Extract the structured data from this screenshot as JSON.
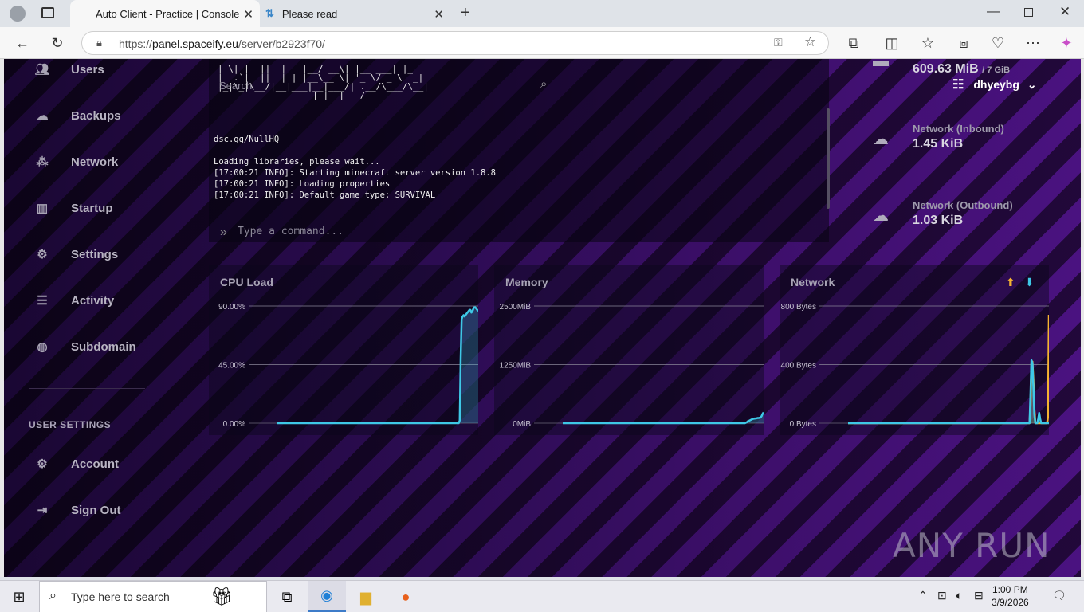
{
  "browser": {
    "tabs": [
      {
        "title": "Auto Client - Practice | Console",
        "active": true
      },
      {
        "title": "Please read",
        "active": false
      }
    ],
    "url_prefix": "https://",
    "url_host": "panel.spaceify.eu",
    "url_path": "/server/b2923f70/"
  },
  "sidebar": {
    "items": [
      {
        "label": "Users",
        "icon": "users-icon"
      },
      {
        "label": "Backups",
        "icon": "cloud-icon"
      },
      {
        "label": "Network",
        "icon": "network-icon"
      },
      {
        "label": "Startup",
        "icon": "chart-icon"
      },
      {
        "label": "Settings",
        "icon": "cogs-icon"
      },
      {
        "label": "Activity",
        "icon": "list-icon"
      },
      {
        "label": "Subdomain",
        "icon": "globe-icon"
      }
    ],
    "user_settings_label": "USER SETTINGS",
    "user_items": [
      {
        "label": "Account",
        "icon": "cogs-icon"
      },
      {
        "label": "Sign Out",
        "icon": "sign-out-icon"
      }
    ]
  },
  "console": {
    "search_placeholder": "Search",
    "lines": [
      "dsc.gg/NullHQ",
      "",
      "Loading libraries, please wait...",
      "[17:00:21 INFO]: Starting minecraft server version 1.8.8",
      "[17:00:21 INFO]: Loading properties",
      "[17:00:21 INFO]: Default game type: SURVIVAL"
    ],
    "command_placeholder": "Type a command..."
  },
  "user_menu": {
    "username": "dhyeybg"
  },
  "stats": {
    "memory_value": "609.63 MiB",
    "memory_limit": "/ 7 GiB",
    "inbound_label": "Network (Inbound)",
    "inbound_value": "1.45 KiB",
    "outbound_label": "Network (Outbound)",
    "outbound_value": "1.03 KiB"
  },
  "chart_data": [
    {
      "type": "area",
      "title": "CPU Load",
      "y_ticks": [
        "90.00%",
        "45.00%",
        "0.00%"
      ],
      "ylim": [
        0,
        90
      ],
      "series": [
        {
          "values": [
            0,
            0,
            0,
            0,
            0,
            0,
            0,
            0,
            0,
            0,
            0,
            0,
            0,
            0,
            0,
            0,
            0,
            0,
            0,
            0,
            0,
            0,
            0,
            0,
            0,
            0,
            0,
            0,
            0,
            0,
            0,
            0,
            0,
            0,
            0,
            0,
            0,
            0,
            0,
            0,
            0,
            0,
            0,
            0,
            0,
            0,
            0,
            0,
            0,
            0,
            0,
            0,
            0,
            0,
            0,
            0,
            0,
            0,
            0,
            0,
            0,
            0,
            0,
            0,
            0,
            0,
            0,
            0,
            0,
            0,
            0,
            0,
            0,
            0,
            0,
            0,
            0,
            0,
            0,
            0,
            0,
            0,
            0,
            0,
            0,
            0,
            0,
            0,
            0,
            0,
            0,
            0,
            0,
            0,
            0,
            0,
            0,
            0,
            0,
            0,
            0,
            0,
            0,
            0,
            0,
            0,
            0,
            0,
            0,
            0,
            0,
            0,
            0,
            0,
            0,
            0,
            0,
            0,
            0,
            0,
            0,
            0,
            0,
            0,
            0,
            0,
            0,
            0,
            0,
            0,
            0,
            0,
            0,
            0,
            0,
            0,
            0,
            0,
            0,
            0,
            0,
            0,
            0,
            0,
            0,
            0,
            0,
            0,
            0,
            0,
            0,
            0,
            0,
            0,
            0,
            0,
            0,
            0,
            0,
            0,
            0,
            0,
            0,
            0,
            0,
            0,
            0,
            0,
            0,
            0,
            0,
            0,
            0,
            0,
            0,
            0,
            0,
            0,
            0,
            0,
            0,
            0,
            0,
            0,
            0,
            0,
            0,
            2,
            50,
            80,
            82,
            83,
            82,
            83,
            84,
            85,
            86,
            87,
            87,
            85,
            86,
            88,
            89,
            89,
            88,
            87,
            86
          ]
        }
      ],
      "color": "#3ec8e6"
    },
    {
      "type": "line",
      "title": "Memory",
      "y_ticks": [
        "2500MiB",
        "1250MiB",
        "0MiB"
      ],
      "ylim": [
        0,
        2500
      ],
      "series": [
        {
          "values": [
            0,
            0,
            0,
            0,
            0,
            0,
            0,
            0,
            0,
            0,
            0,
            0,
            0,
            0,
            0,
            0,
            0,
            0,
            0,
            0,
            0,
            0,
            0,
            0,
            0,
            0,
            0,
            0,
            0,
            0,
            0,
            0,
            0,
            0,
            0,
            0,
            0,
            0,
            0,
            0,
            0,
            0,
            0,
            0,
            0,
            0,
            0,
            0,
            0,
            0,
            0,
            0,
            0,
            0,
            0,
            0,
            0,
            0,
            0,
            0,
            0,
            0,
            0,
            0,
            0,
            0,
            0,
            0,
            0,
            0,
            0,
            0,
            0,
            0,
            0,
            0,
            0,
            0,
            0,
            0,
            0,
            0,
            0,
            0,
            0,
            0,
            0,
            0,
            0,
            0,
            0,
            0,
            0,
            0,
            0,
            0,
            0,
            0,
            0,
            0,
            0,
            0,
            0,
            0,
            0,
            0,
            0,
            0,
            0,
            0,
            0,
            0,
            0,
            0,
            0,
            0,
            0,
            0,
            0,
            0,
            0,
            0,
            0,
            0,
            0,
            0,
            0,
            0,
            0,
            0,
            0,
            0,
            0,
            0,
            0,
            0,
            0,
            0,
            0,
            0,
            0,
            0,
            0,
            0,
            0,
            0,
            0,
            0,
            0,
            0,
            0,
            0,
            0,
            0,
            0,
            0,
            0,
            0,
            0,
            0,
            0,
            0,
            0,
            0,
            0,
            0,
            0,
            0,
            0,
            0,
            0,
            0,
            0,
            0,
            0,
            0,
            0,
            0,
            0,
            0,
            0,
            0,
            0,
            0,
            0,
            0,
            0,
            10,
            20,
            40,
            50,
            60,
            70,
            80,
            90,
            95,
            100,
            100,
            105,
            110,
            110,
            115,
            120,
            150,
            200,
            230
          ]
        }
      ],
      "color": "#3ec8e6"
    },
    {
      "type": "line",
      "title": "Network",
      "y_ticks": [
        "800 Bytes",
        "400 Bytes",
        "0 Bytes"
      ],
      "ylim": [
        0,
        800
      ],
      "series": [
        {
          "values": [
            0,
            0,
            0,
            0,
            0,
            0,
            0,
            0,
            0,
            0,
            0,
            0,
            0,
            0,
            0,
            0,
            0,
            0,
            0,
            0,
            0,
            0,
            0,
            0,
            0,
            0,
            0,
            0,
            0,
            0,
            0,
            0,
            0,
            0,
            0,
            0,
            0,
            0,
            0,
            0,
            0,
            0,
            0,
            0,
            0,
            0,
            0,
            0,
            0,
            0,
            0,
            0,
            0,
            0,
            0,
            0,
            0,
            0,
            0,
            0,
            0,
            0,
            0,
            0,
            0,
            0,
            0,
            0,
            0,
            0,
            0,
            0,
            0,
            0,
            0,
            0,
            0,
            0,
            0,
            0,
            0,
            0,
            0,
            0,
            0,
            0,
            0,
            0,
            0,
            0,
            0,
            0,
            0,
            0,
            0,
            0,
            0,
            0,
            0,
            0,
            0,
            0,
            0,
            0,
            0,
            0,
            0,
            0,
            0,
            0,
            0,
            0,
            0,
            0,
            0,
            0,
            0,
            0,
            0,
            0,
            0,
            0,
            0,
            0,
            0,
            0,
            0,
            0,
            0,
            0,
            0,
            0,
            0,
            0,
            0,
            0,
            0,
            0,
            0,
            0,
            0,
            0,
            0,
            0,
            0,
            0,
            0,
            0,
            0,
            0,
            0,
            0,
            0,
            0,
            0,
            0,
            0,
            0,
            0,
            0,
            0,
            0,
            0,
            0,
            0,
            0,
            0,
            0,
            0,
            0,
            0,
            0,
            0,
            0,
            0,
            0,
            0,
            0,
            0,
            0,
            0,
            0,
            0,
            0,
            0,
            0,
            0,
            0,
            120,
            410,
            420,
            300,
            100,
            0,
            0,
            0,
            0,
            0,
            0,
            0,
            0,
            0,
            0,
            0,
            0,
            0,
            40,
            740
          ]
        },
        {
          "values": [
            0,
            0,
            0,
            0,
            0,
            0,
            0,
            0,
            0,
            0,
            0,
            0,
            0,
            0,
            0,
            0,
            0,
            0,
            0,
            0,
            0,
            0,
            0,
            0,
            0,
            0,
            0,
            0,
            0,
            0,
            0,
            0,
            0,
            0,
            0,
            0,
            0,
            0,
            0,
            0,
            0,
            0,
            0,
            0,
            0,
            0,
            0,
            0,
            0,
            0,
            0,
            0,
            0,
            0,
            0,
            0,
            0,
            0,
            0,
            0,
            0,
            0,
            0,
            0,
            0,
            0,
            0,
            0,
            0,
            0,
            0,
            0,
            0,
            0,
            0,
            0,
            0,
            0,
            0,
            0,
            0,
            0,
            0,
            0,
            0,
            0,
            0,
            0,
            0,
            0,
            0,
            0,
            0,
            0,
            0,
            0,
            0,
            0,
            0,
            0,
            0,
            0,
            0,
            0,
            0,
            0,
            0,
            0,
            0,
            0,
            0,
            0,
            0,
            0,
            0,
            0,
            0,
            0,
            0,
            0,
            0,
            0,
            0,
            0,
            0,
            0,
            0,
            0,
            0,
            0,
            0,
            0,
            0,
            0,
            0,
            0,
            0,
            0,
            0,
            0,
            0,
            0,
            0,
            0,
            0,
            0,
            0,
            0,
            0,
            0,
            0,
            0,
            0,
            0,
            0,
            0,
            0,
            0,
            0,
            0,
            0,
            0,
            0,
            0,
            0,
            0,
            0,
            0,
            0,
            0,
            0,
            0,
            0,
            0,
            0,
            0,
            0,
            0,
            0,
            0,
            0,
            0,
            0,
            0,
            0,
            0,
            0,
            0,
            200,
            430,
            410,
            250,
            60,
            0,
            0,
            0,
            30,
            70,
            30,
            0,
            0,
            0,
            0,
            0,
            0,
            0,
            0,
            0
          ]
        }
      ],
      "colors": [
        "#f5b431",
        "#3ec8e6"
      ]
    }
  ],
  "watermark": "ANY RUN",
  "taskbar": {
    "search_placeholder": "Type here to search",
    "time": "1:00 PM",
    "date": "3/9/2026"
  }
}
